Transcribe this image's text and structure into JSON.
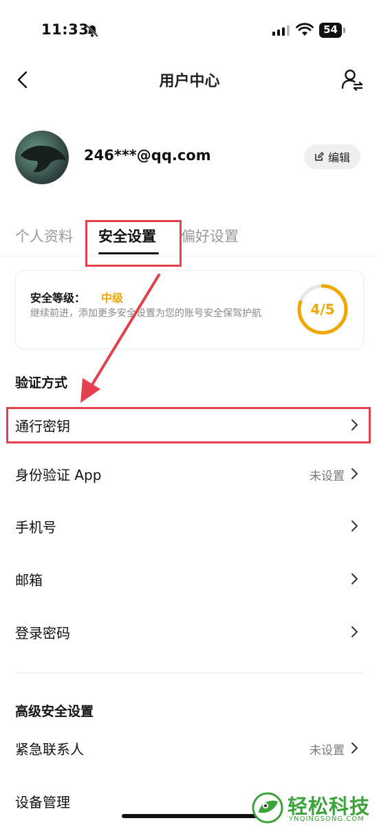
{
  "status_bar": {
    "time": "11:33",
    "battery": "54"
  },
  "nav": {
    "title": "用户中心"
  },
  "profile": {
    "email": "246***@qq.com",
    "edit_label": "编辑"
  },
  "tabs": [
    {
      "label": "个人资料",
      "active": false
    },
    {
      "label": "安全设置",
      "active": true
    },
    {
      "label": "偏好设置",
      "active": false
    }
  ],
  "security": {
    "level_label": "安全等级：",
    "level_value": "中级",
    "description": "继续前进，添加更多安全设置为您的账号安全保驾护航",
    "score_text": "4/5",
    "score": 4,
    "score_max": 5
  },
  "verification": {
    "title": "验证方式",
    "items": [
      {
        "label": "通行密钥",
        "status": ""
      },
      {
        "label": "身份验证 App",
        "status": "未设置"
      },
      {
        "label": "手机号",
        "status": ""
      },
      {
        "label": "邮箱",
        "status": ""
      },
      {
        "label": "登录密码",
        "status": ""
      }
    ]
  },
  "advanced": {
    "title": "高级安全设置",
    "items": [
      {
        "label": "紧急联系人",
        "status": "未设置"
      },
      {
        "label": "设备管理",
        "status": ""
      }
    ]
  },
  "watermark": {
    "text": "轻松科技",
    "sub": "YNQINGSONG.COM"
  },
  "colors": {
    "accent": "#f0a800",
    "annotation": "#e4414e",
    "watermark": "#3aa43a"
  }
}
